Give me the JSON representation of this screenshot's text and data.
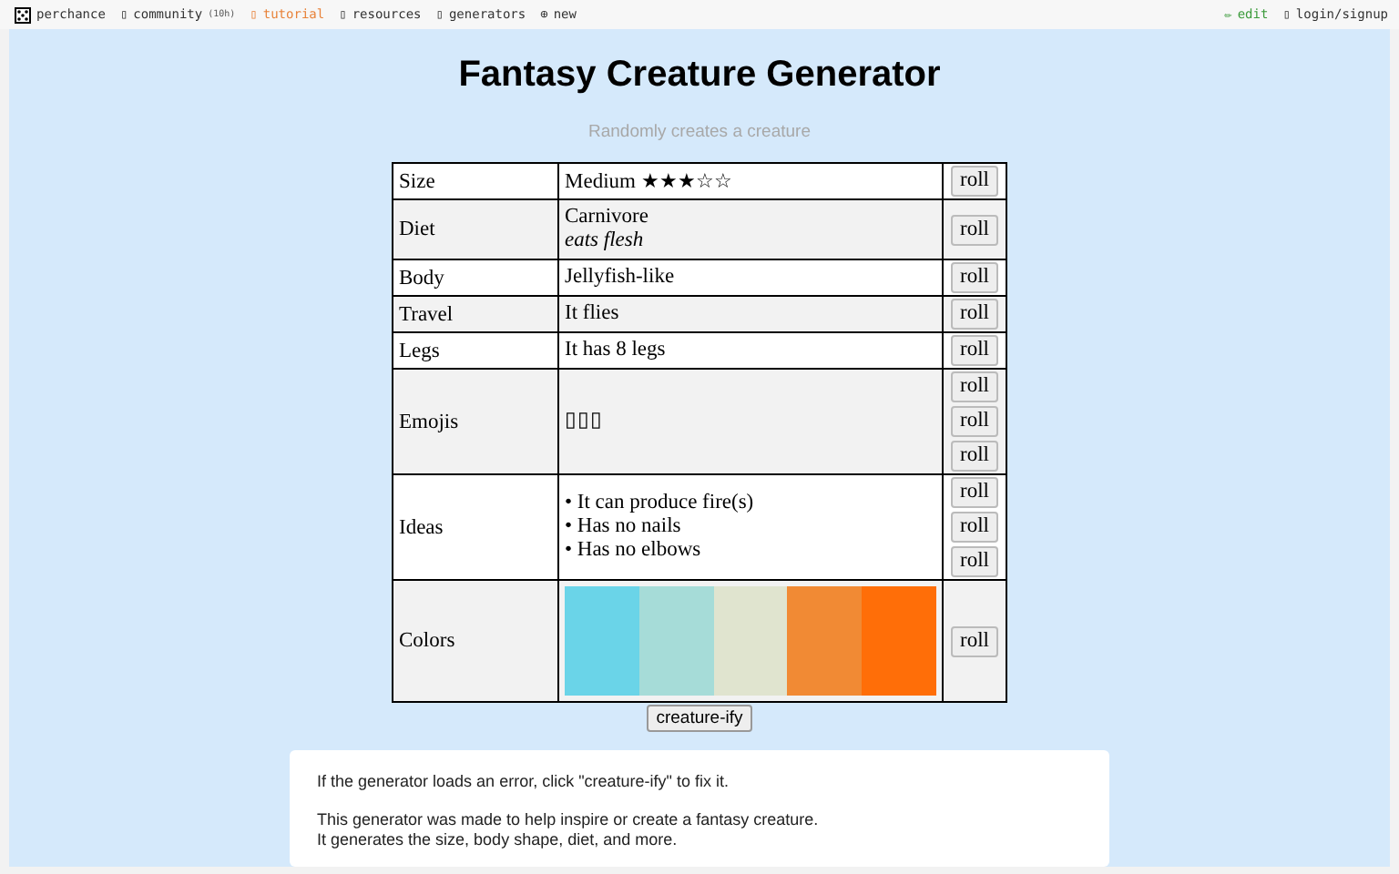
{
  "nav": {
    "left": [
      {
        "kind": "dice",
        "label": "perchance",
        "color": "#333333"
      },
      {
        "kind": "glyph",
        "glyph": "▯",
        "label": "community",
        "note": "(10h)",
        "color": "#333333"
      },
      {
        "kind": "glyph",
        "glyph": "▯",
        "label": "tutorial",
        "color": "#e8833a"
      },
      {
        "kind": "glyph",
        "glyph": "▯",
        "label": "resources",
        "color": "#333333"
      },
      {
        "kind": "glyph",
        "glyph": "▯",
        "label": "generators",
        "color": "#333333"
      },
      {
        "kind": "glyph",
        "glyph": "⊕",
        "label": "new",
        "color": "#333333"
      }
    ],
    "right": [
      {
        "kind": "glyph",
        "glyph": "✏",
        "label": "edit",
        "color": "#3a9a3a"
      },
      {
        "kind": "glyph",
        "glyph": "▯",
        "label": "login/signup",
        "color": "#333333"
      }
    ]
  },
  "title": "Fantasy Creature Generator",
  "subtitle": "Randomly creates a creature",
  "rows": [
    {
      "kind": "stars",
      "label": "Size",
      "value": "Medium",
      "stars": 3,
      "buttons": [
        "roll"
      ]
    },
    {
      "kind": "lines",
      "label": "Diet",
      "lines": [
        {
          "text": "Carnivore",
          "italic": false
        },
        {
          "text": "eats flesh",
          "italic": true
        }
      ],
      "buttons": [
        "roll"
      ]
    },
    {
      "kind": "lines",
      "label": "Body",
      "lines": [
        {
          "text": "Jellyfish-like",
          "italic": false
        }
      ],
      "buttons": [
        "roll"
      ]
    },
    {
      "kind": "lines",
      "label": "Travel",
      "lines": [
        {
          "text": "It flies",
          "italic": false
        }
      ],
      "buttons": [
        "roll"
      ]
    },
    {
      "kind": "lines",
      "label": "Legs",
      "lines": [
        {
          "text": "It has 8 legs",
          "italic": false
        }
      ],
      "buttons": [
        "roll"
      ]
    },
    {
      "kind": "lines",
      "label": "Emojis",
      "lines": [
        {
          "text": "▯▯▯",
          "italic": false
        }
      ],
      "buttons": [
        "roll",
        "roll",
        "roll"
      ]
    },
    {
      "kind": "lines",
      "label": "Ideas",
      "lines": [
        {
          "text": "• It can produce fire(s)",
          "italic": false
        },
        {
          "text": "• Has no nails",
          "italic": false
        },
        {
          "text": "• Has no elbows",
          "italic": false
        }
      ],
      "buttons": [
        "roll",
        "roll",
        "roll"
      ]
    },
    {
      "kind": "colors",
      "label": "Colors",
      "colors": [
        {
          "color": "#6ad4e8"
        },
        {
          "color": "#a6dcd8"
        },
        {
          "color": "#e0e4cf"
        },
        {
          "color": "#f18a34"
        },
        {
          "color": "#ff6e08"
        }
      ],
      "buttons": [
        "roll"
      ]
    }
  ],
  "action": "creature-ify",
  "info": [
    "If the generator loads an error, click \"creature-ify\" to fix it.",
    "This generator was made to help inspire or create a fantasy creature.",
    "It generates the size, body shape, diet, and more."
  ]
}
